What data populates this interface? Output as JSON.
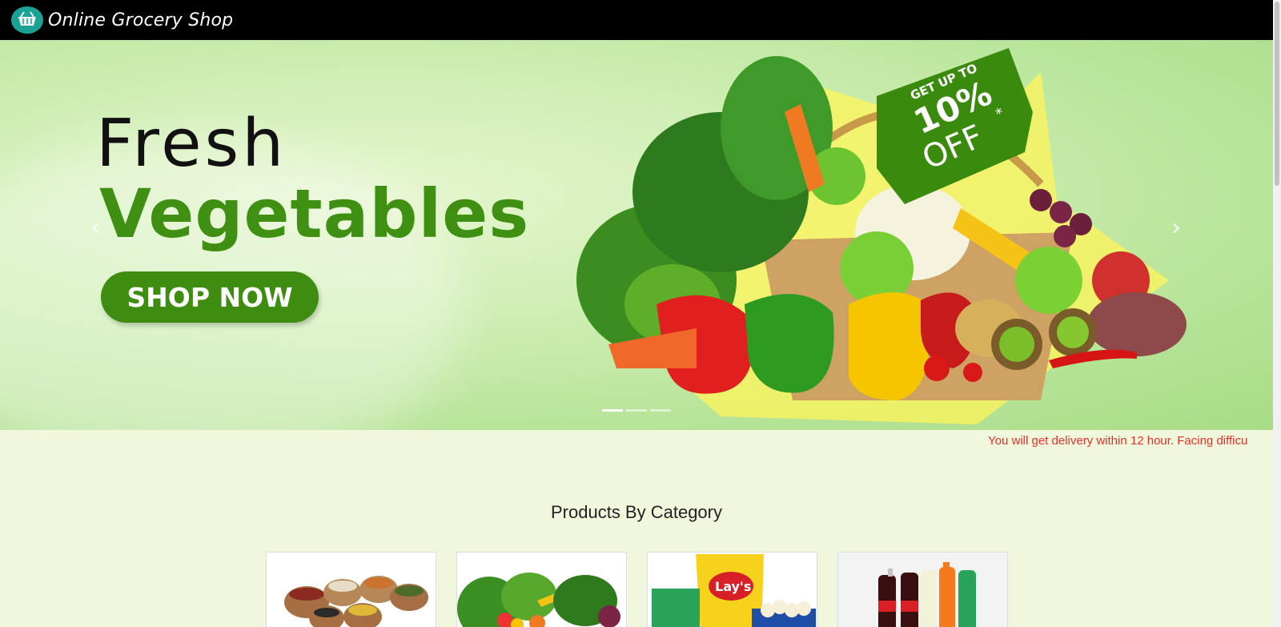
{
  "header": {
    "brand": "Online Grocery Shop",
    "logo_icon": "basket-icon"
  },
  "hero": {
    "title_line1": "Fresh",
    "title_line2": "Vegetables",
    "cta_label": "SHOP NOW",
    "badge_line1": "GET UP TO",
    "badge_line2": "10%",
    "badge_line3": "OFF",
    "badge_asterisk": "*",
    "prev_icon": "chevron-left-icon",
    "next_icon": "chevron-right-icon",
    "slide_count": 3,
    "active_slide": 1
  },
  "ticker": {
    "text": "You will get delivery within 12 hour. Facing difficu"
  },
  "categories": {
    "title": "Products By Category",
    "items": [
      {
        "name": "pulses-category",
        "icon": "grains-image"
      },
      {
        "name": "vegetables-category",
        "icon": "vegetables-image"
      },
      {
        "name": "snacks-category",
        "icon": "snacks-image"
      },
      {
        "name": "beverages-category",
        "icon": "beverages-image"
      }
    ]
  },
  "colors": {
    "header_bg": "#000000",
    "accent_green": "#3e8c10",
    "ticker_red": "#e8302a",
    "page_bg": "#f1f7dc"
  }
}
